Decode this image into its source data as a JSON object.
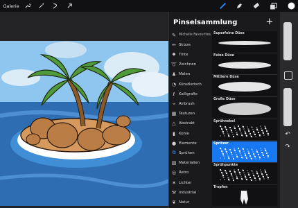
{
  "topbar": {
    "gallery_label": "Galerie",
    "icons": [
      "wrench-icon",
      "magic-wand-icon",
      "selection-icon",
      "transform-arrow-icon",
      "brush-icon",
      "smudge-icon",
      "eraser-icon",
      "layers-icon",
      "color-icon"
    ],
    "accent": "#1e90ff"
  },
  "panel": {
    "title": "Pinselsammlung",
    "add_symbol": "+",
    "categories": [
      {
        "label": "Michelle Favourites",
        "icon": "brush-icon"
      },
      {
        "label": "Skizze",
        "icon": "pencil-icon"
      },
      {
        "label": "Tinte",
        "icon": "ink-drop-icon"
      },
      {
        "label": "Zeichnen",
        "icon": "drawing-icon"
      },
      {
        "label": "Malen",
        "icon": "paint-brush-icon"
      },
      {
        "label": "Künstlerisch",
        "icon": "palette-icon"
      },
      {
        "label": "Kalligrafie",
        "icon": "calligraphy-icon"
      },
      {
        "label": "Airbrush",
        "icon": "airbrush-icon"
      },
      {
        "label": "Texturen",
        "icon": "texture-icon"
      },
      {
        "label": "Abstrakt",
        "icon": "triangle-icon"
      },
      {
        "label": "Kohle",
        "icon": "charcoal-icon"
      },
      {
        "label": "Elemente",
        "icon": "drop-icon"
      },
      {
        "label": "Sprühen",
        "icon": "spray-can-icon"
      },
      {
        "label": "Materialien",
        "icon": "cube-icon"
      },
      {
        "label": "Retro",
        "icon": "retro-icon"
      },
      {
        "label": "Lichter",
        "icon": "sparkle-icon"
      },
      {
        "label": "Industrial",
        "icon": "anvil-icon"
      },
      {
        "label": "Natur",
        "icon": "leaf-icon"
      }
    ],
    "selected_category": "Sprühen",
    "brushes": [
      {
        "label": "Superfeine Düse"
      },
      {
        "label": "Feine Düse"
      },
      {
        "label": "Mittlere Düse"
      },
      {
        "label": "Große Düse"
      },
      {
        "label": "Sprühnebel"
      },
      {
        "label": "Spritzer"
      },
      {
        "label": "Sprühpunkte"
      },
      {
        "label": "Tropfen"
      }
    ],
    "selected_brush": "Spritzer",
    "selected_color": "#1778f2"
  }
}
